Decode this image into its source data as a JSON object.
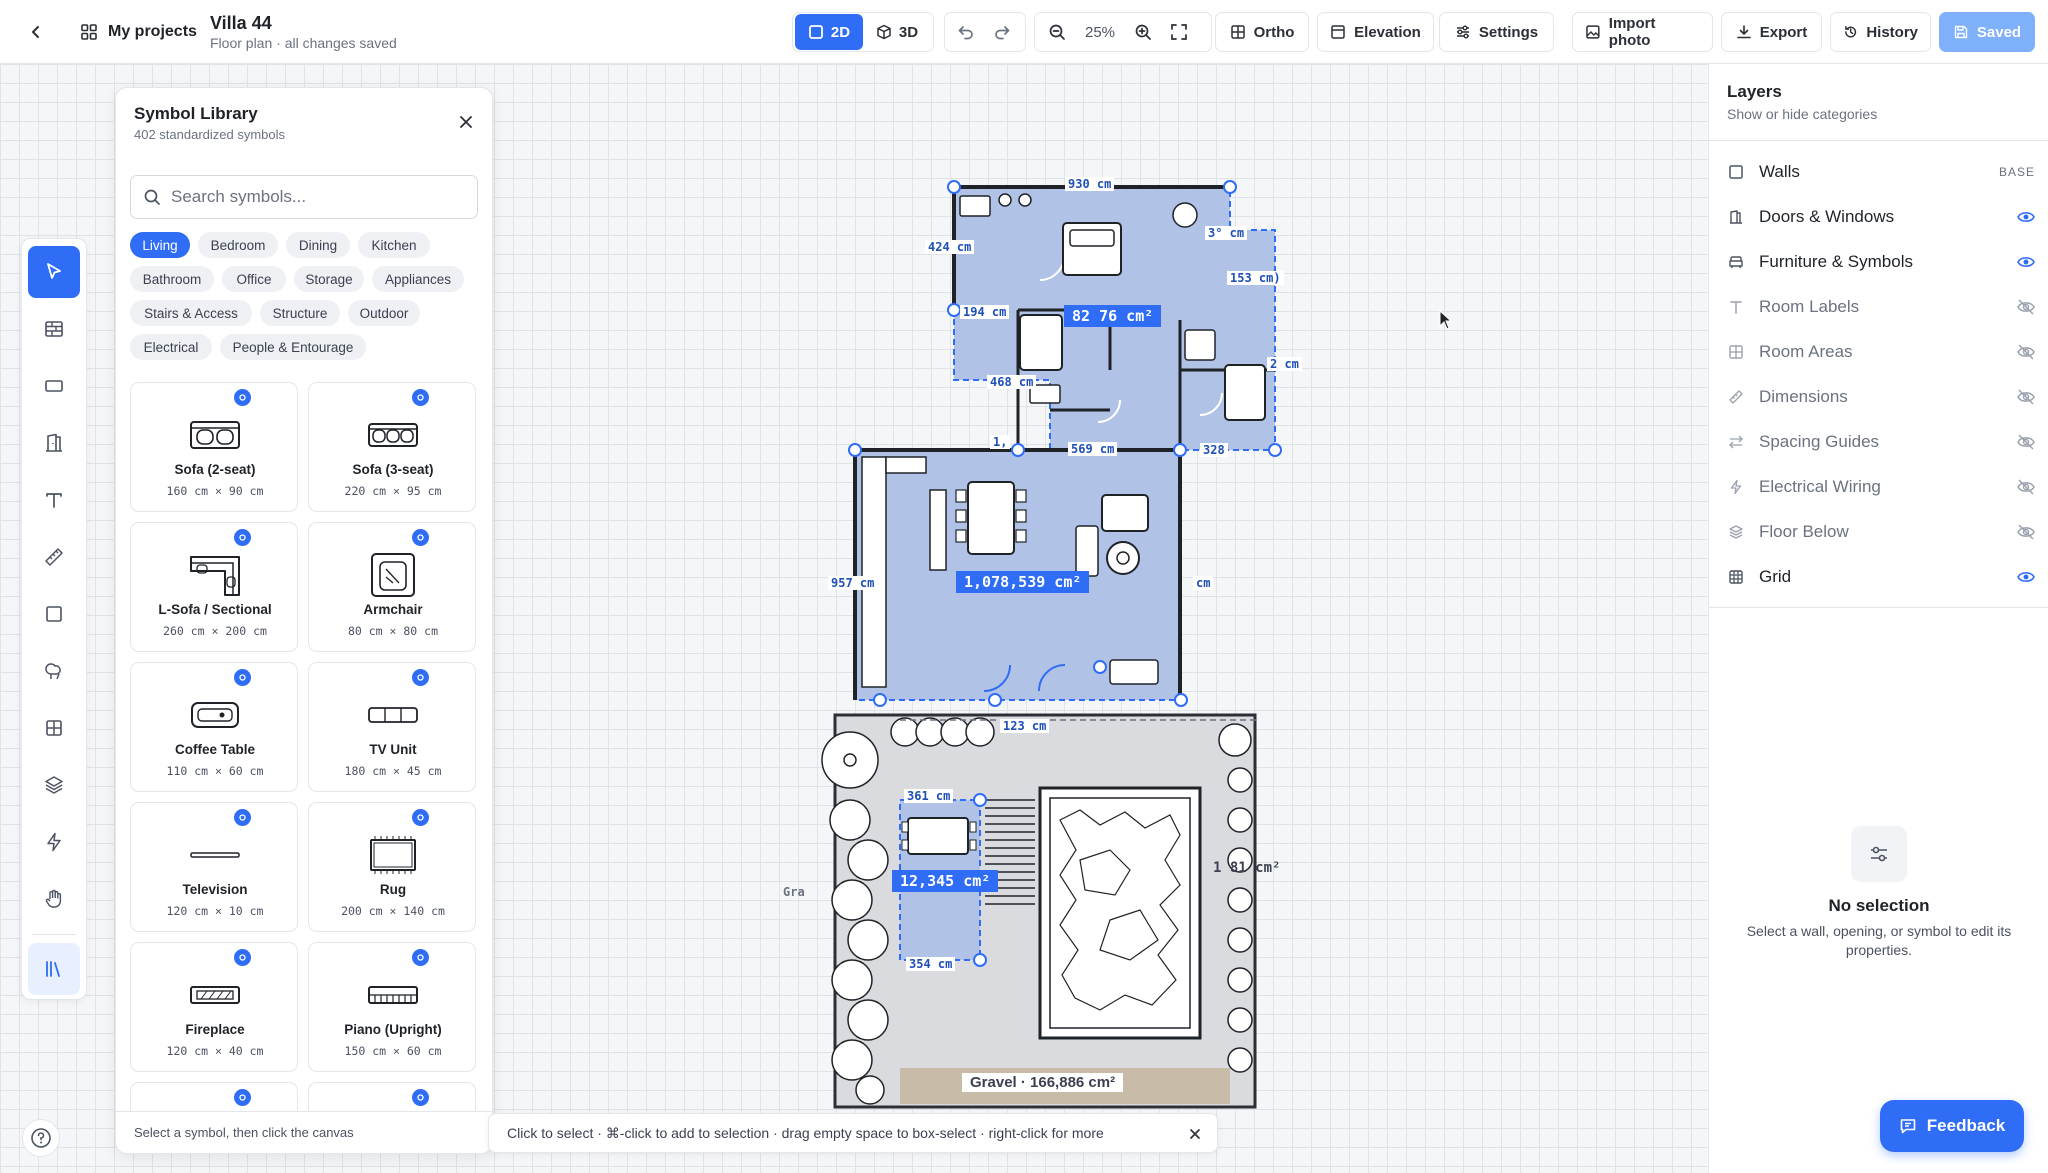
{
  "header": {
    "back_label": "",
    "my_projects": "My projects",
    "project_title": "Villa 44",
    "project_subtitle": "Floor plan · all changes saved",
    "view_2d": "2D",
    "view_3d": "3D",
    "zoom": "25%",
    "ortho": "Ortho",
    "elevation": "Elevation",
    "settings": "Settings",
    "import_photo": "Import photo",
    "export": "Export",
    "history": "History",
    "saved": "Saved"
  },
  "library": {
    "title": "Symbol Library",
    "subtitle": "402 standardized symbols",
    "search_placeholder": "Search symbols...",
    "categories": [
      "Living",
      "Bedroom",
      "Dining",
      "Kitchen",
      "Bathroom",
      "Office",
      "Storage",
      "Appliances",
      "Stairs & Access",
      "Structure",
      "Outdoor",
      "Electrical",
      "People & Entourage"
    ],
    "active_category": "Living",
    "symbols": [
      {
        "name": "Sofa (2-seat)",
        "dims": "160 cm × 90 cm",
        "icon": "sofa-2-icon"
      },
      {
        "name": "Sofa (3-seat)",
        "dims": "220 cm × 95 cm",
        "icon": "sofa-3-icon"
      },
      {
        "name": "L-Sofa / Sectional",
        "dims": "260 cm × 200 cm",
        "icon": "l-sofa-icon"
      },
      {
        "name": "Armchair",
        "dims": "80 cm × 80 cm",
        "icon": "armchair-icon"
      },
      {
        "name": "Coffee Table",
        "dims": "110 cm × 60 cm",
        "icon": "coffee-table-icon"
      },
      {
        "name": "TV Unit",
        "dims": "180 cm × 45 cm",
        "icon": "tv-unit-icon"
      },
      {
        "name": "Television",
        "dims": "120 cm × 10 cm",
        "icon": "television-icon"
      },
      {
        "name": "Rug",
        "dims": "200 cm × 140 cm",
        "icon": "rug-icon"
      },
      {
        "name": "Fireplace",
        "dims": "120 cm × 40 cm",
        "icon": "fireplace-icon"
      },
      {
        "name": "Piano (Upright)",
        "dims": "150 cm × 60 cm",
        "icon": "piano-icon"
      }
    ],
    "footer": "Select a symbol, then click the canvas"
  },
  "hint": "Click to select · ⌘-click to add to selection · drag empty space to box-select · right-click for more",
  "plan": {
    "dims": [
      "930 cm",
      "424 cm",
      "3° cm",
      "153 cm)",
      "194 cm",
      "2 cm",
      "468 cm",
      "1,",
      "569 cm",
      "328",
      "957 cm",
      "cm",
      "123 cm",
      "361 cm",
      "354 cm",
      "Gra"
    ],
    "areas": [
      "82 76 cm²",
      "1,078,539 cm²",
      "12,345 cm²"
    ],
    "outdoor_area": "1 81 cm²",
    "gravel_label": "Gravel · 166,886 cm²"
  },
  "layers": {
    "title": "Layers",
    "subtitle": "Show or hide categories",
    "base_tag": "BASE",
    "items": [
      {
        "name": "Walls",
        "visible": true,
        "base": true,
        "icon": "square-icon"
      },
      {
        "name": "Doors & Windows",
        "visible": true,
        "base": false,
        "icon": "door-icon"
      },
      {
        "name": "Furniture & Symbols",
        "visible": true,
        "base": false,
        "icon": "sofa-icon"
      },
      {
        "name": "Room Labels",
        "visible": false,
        "base": false,
        "icon": "text-icon"
      },
      {
        "name": "Room Areas",
        "visible": false,
        "base": false,
        "icon": "grid-icon"
      },
      {
        "name": "Dimensions",
        "visible": false,
        "base": false,
        "icon": "ruler-icon"
      },
      {
        "name": "Spacing Guides",
        "visible": false,
        "base": false,
        "icon": "spacing-icon"
      },
      {
        "name": "Electrical Wiring",
        "visible": false,
        "base": false,
        "icon": "bolt-icon"
      },
      {
        "name": "Floor Below",
        "visible": false,
        "base": false,
        "icon": "layers-icon"
      },
      {
        "name": "Grid",
        "visible": true,
        "base": false,
        "icon": "grid-icon"
      }
    ],
    "no_selection_title": "No selection",
    "no_selection_text": "Select a wall, opening, or symbol to edit its properties."
  },
  "feedback": "Feedback",
  "colors": {
    "accent": "#2f6df6",
    "room_fill": "#b0c3e6",
    "saved_bg": "#7fb0fb"
  }
}
